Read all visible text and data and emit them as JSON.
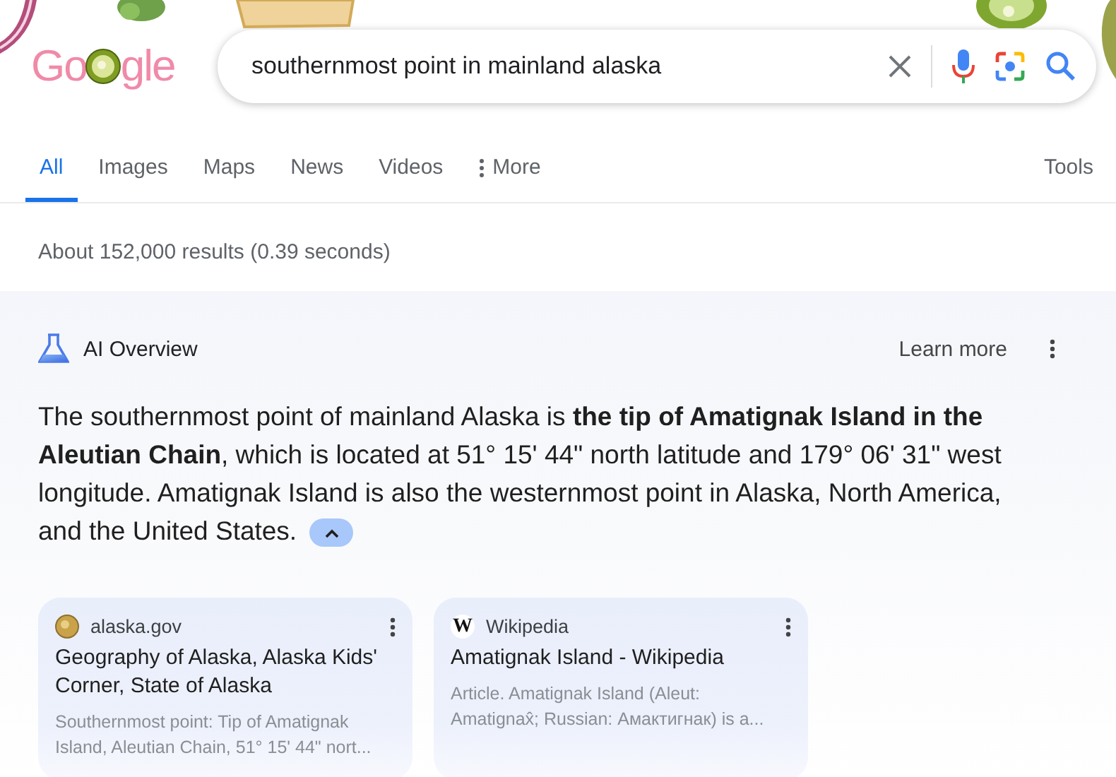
{
  "logo": {
    "before": "Go",
    "after": "gle"
  },
  "search": {
    "value": "southernmost point in mainland alaska"
  },
  "tabs": [
    {
      "label": "All",
      "selected": true,
      "kind": "plain"
    },
    {
      "label": "Images",
      "selected": false,
      "kind": "plain"
    },
    {
      "label": "Maps",
      "selected": false,
      "kind": "plain"
    },
    {
      "label": "News",
      "selected": false,
      "kind": "plain"
    },
    {
      "label": "Videos",
      "selected": false,
      "kind": "plain"
    },
    {
      "label": "More",
      "selected": false,
      "kind": "menu"
    }
  ],
  "tools": "Tools",
  "result_stats": "About 152,000 results (0.39 seconds)",
  "ai_overview": {
    "title": "AI Overview",
    "learn_more": "Learn more",
    "expanded": true,
    "text": "The southernmost point of mainland Alaska is **the tip of Amatignak Island in the Aleutian Chain**, which is located at 51° 15' 44\" north latitude and 179° 06' 31\" west longitude. Amatignak Island is also the westernmost point in Alaska, North America, and the United States."
  },
  "sources": [
    {
      "site": "alaska.gov",
      "kind": "globe",
      "title": "Geography of Alaska, Alaska Kids' Corner, State of Alaska",
      "snippet": "Southernmost point: Tip of Amatignak Island, Aleutian Chain, 51° 15' 44\" nort..."
    },
    {
      "site": "Wikipedia",
      "kind": "letter",
      "favicon_letter": "W",
      "title": "Amatignak Island - Wikipedia",
      "snippet": "Article. Amatignak Island (Aleut: Amatignax̂; Russian: Амактигнак) is a..."
    }
  ]
}
